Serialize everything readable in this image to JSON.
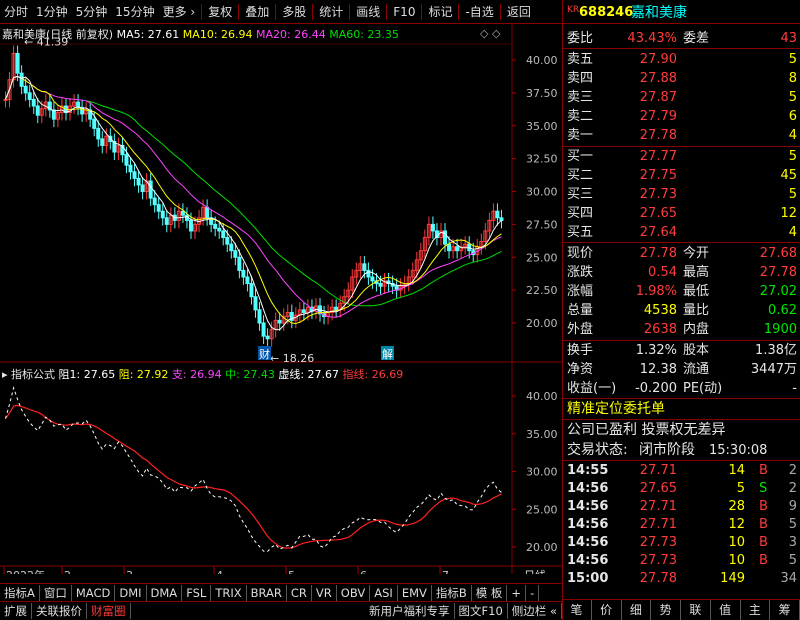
{
  "toolbar": {
    "items": [
      "分时",
      "1分钟",
      "5分钟",
      "15分钟",
      "更多",
      "复权",
      "叠加",
      "多股",
      "统计",
      "画线",
      "F10",
      "标记",
      "-自选",
      "返回"
    ]
  },
  "main_chart": {
    "title": "嘉和美康(日线 前复权)",
    "ma_labels": [
      {
        "text": "MA5: 27.61",
        "color": "#ffffff"
      },
      {
        "text": "MA10: 26.94",
        "color": "#ffff00"
      },
      {
        "text": "MA20: 26.44",
        "color": "#ff44ff"
      },
      {
        "text": "MA60: 23.35",
        "color": "#00dd00"
      }
    ],
    "y_ticks": [
      "40.00",
      "37.50",
      "35.00",
      "32.50",
      "30.00",
      "27.50",
      "25.00",
      "22.50",
      "20.00"
    ],
    "high_marker": "41.39",
    "low_marker": "18.26",
    "event_markers": [
      "财",
      "解"
    ]
  },
  "indicator_chart": {
    "title": "指标公式",
    "labels": [
      {
        "text": "阻1: 27.65",
        "color": "#ffffff"
      },
      {
        "text": "阻: 27.92",
        "color": "#ffff00"
      },
      {
        "text": "支: 26.94",
        "color": "#ff44ff"
      },
      {
        "text": "中: 27.43",
        "color": "#00dd00"
      },
      {
        "text": "虚线: 27.67",
        "color": "#ffffff"
      },
      {
        "text": "指线: 26.69",
        "color": "#ff3b3b"
      }
    ],
    "y_ticks": [
      "40.00",
      "35.00",
      "30.00",
      "25.00",
      "20.00"
    ]
  },
  "x_axis": {
    "labels": [
      "2022年",
      "2",
      "3",
      "4",
      "5",
      "6",
      "7"
    ],
    "period": "日线"
  },
  "indicator_tabs": [
    "指标A",
    "窗口",
    "MACD",
    "DMI",
    "DMA",
    "FSL",
    "TRIX",
    "BRAR",
    "CR",
    "VR",
    "OBV",
    "ASI",
    "EMV",
    "指标B",
    "模 板",
    "+",
    "-"
  ],
  "statusbar": [
    "扩展",
    "关联报价",
    "财富圈",
    "新用户福利专享",
    "图文F10",
    "侧边栏"
  ],
  "quote": {
    "market": "KR",
    "code": "688246",
    "name": "嘉和美康",
    "webi_label": "委比",
    "webi": "43.43%",
    "weicha_label": "委差",
    "weicha": "43",
    "asks": [
      {
        "label": "卖五",
        "price": "27.90",
        "vol": "5"
      },
      {
        "label": "卖四",
        "price": "27.88",
        "vol": "8"
      },
      {
        "label": "卖三",
        "price": "27.87",
        "vol": "5"
      },
      {
        "label": "卖二",
        "price": "27.79",
        "vol": "6"
      },
      {
        "label": "卖一",
        "price": "27.78",
        "vol": "4"
      }
    ],
    "bids": [
      {
        "label": "买一",
        "price": "27.77",
        "vol": "5"
      },
      {
        "label": "买二",
        "price": "27.75",
        "vol": "45"
      },
      {
        "label": "买三",
        "price": "27.73",
        "vol": "5"
      },
      {
        "label": "买四",
        "price": "27.65",
        "vol": "12"
      },
      {
        "label": "买五",
        "price": "27.64",
        "vol": "4"
      }
    ],
    "stats": [
      {
        "l1": "现价",
        "v1": "27.78",
        "c1": "red",
        "l2": "今开",
        "v2": "27.68",
        "c2": "red"
      },
      {
        "l1": "涨跌",
        "v1": "0.54",
        "c1": "red",
        "l2": "最高",
        "v2": "27.78",
        "c2": "red"
      },
      {
        "l1": "涨幅",
        "v1": "1.98%",
        "c1": "red",
        "l2": "最低",
        "v2": "27.02",
        "c2": "green"
      },
      {
        "l1": "总量",
        "v1": "4538",
        "c1": "yellow",
        "l2": "量比",
        "v2": "0.62",
        "c2": "green"
      },
      {
        "l1": "外盘",
        "v1": "2638",
        "c1": "red",
        "l2": "内盘",
        "v2": "1900",
        "c2": "green"
      }
    ],
    "stats2": [
      {
        "l1": "换手",
        "v1": "1.32%",
        "l2": "股本",
        "v2": "1.38亿"
      },
      {
        "l1": "净资",
        "v1": "12.38",
        "l2": "流通",
        "v2": "3447万"
      },
      {
        "l1": "收益(一)",
        "v1": "-0.200",
        "l2": "PE(动)",
        "v2": "-"
      }
    ],
    "promo": "精准定位委托单",
    "info": "公司已盈利 投票权无差异",
    "trade_status_label": "交易状态:",
    "trade_status": "闭市阶段",
    "trade_time": "15:30:08",
    "ticks": [
      {
        "time": "14:55",
        "price": "27.71",
        "vol": "14",
        "side": "B",
        "num": "2"
      },
      {
        "time": "14:56",
        "price": "27.65",
        "vol": "5",
        "side": "S",
        "num": "2"
      },
      {
        "time": "14:56",
        "price": "27.71",
        "vol": "28",
        "side": "B",
        "num": "9"
      },
      {
        "time": "14:56",
        "price": "27.71",
        "vol": "12",
        "side": "B",
        "num": "5"
      },
      {
        "time": "14:56",
        "price": "27.73",
        "vol": "10",
        "side": "B",
        "num": "3"
      },
      {
        "time": "14:56",
        "price": "27.73",
        "vol": "10",
        "side": "B",
        "num": "5"
      },
      {
        "time": "15:00",
        "price": "27.78",
        "vol": "149",
        "side": "",
        "num": "34"
      }
    ],
    "bottom_tabs": [
      "笔",
      "价",
      "细",
      "势",
      "联",
      "值",
      "主",
      "筹"
    ]
  }
}
